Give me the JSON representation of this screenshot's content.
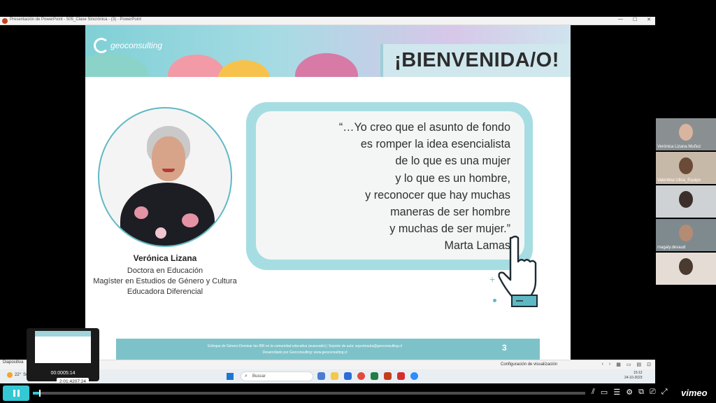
{
  "window": {
    "title": "Presentación de PowerPoint  -  505_Clase Sincrónica - (3) - PowerPoint",
    "controls": [
      "—",
      "☐",
      "✕"
    ]
  },
  "slide": {
    "logo_text": "geoconsulting",
    "heading": "¡BIENVENIDA/O!",
    "speaker": {
      "name": "Verónica Lizana",
      "credentials": [
        "Doctora en Educación",
        "Magíster en Estudios de Género y Cultura",
        "Educadora Diferencial"
      ]
    },
    "quote_lines": [
      "“…Yo creo que el asunto de fondo",
      "es romper la idea esencialista",
      "de lo que es una mujer",
      "y lo que es un hombre,",
      "y reconocer que hay muchas",
      "maneras de ser hombre",
      "y muchas de ser mujer.”",
      "Marta Lamas"
    ],
    "footer_line1": "Enfoque de Género:Dominar las IBR en la comunidad educativa (avanzado) | Soporte de aula: soporteaula@geoconsulting.cl",
    "footer_line2": "Desarrollado por Geoconsulting: www.geoconsulting.cl",
    "number": "3",
    "colors": {
      "accent": "#7ec2c9",
      "quote_frame": "#a6dde3"
    }
  },
  "statusbar": {
    "left": "Diapositiva",
    "view_settings": "Configuración de visualización",
    "icons": [
      "chevron-left-icon",
      "chevron-right-icon",
      "grid-icon",
      "normal-view-icon",
      "reading-view-icon",
      "zoom-fit-icon"
    ]
  },
  "taskbar": {
    "weather_temp": "22°",
    "weather_desc": "Sol",
    "search_placeholder": "Buscar",
    "time": "15:12",
    "date": "24-10-2023"
  },
  "preview": {
    "time": "00:0005:14",
    "scrub_time": "2:01:4207:24"
  },
  "participants": [
    {
      "name": "Verónica Lizana Muñoz"
    },
    {
      "name": "Valentina Ulloa_Equipo"
    },
    {
      "name": ""
    },
    {
      "name": "magaly.devaud"
    },
    {
      "name": ""
    }
  ],
  "player": {
    "progress": 0.012,
    "brand": "vimeo",
    "icons": [
      "speed-icon",
      "captions-icon",
      "transcript-icon",
      "settings-icon",
      "pip-icon",
      "cast-icon",
      "fullscreen-icon"
    ]
  }
}
